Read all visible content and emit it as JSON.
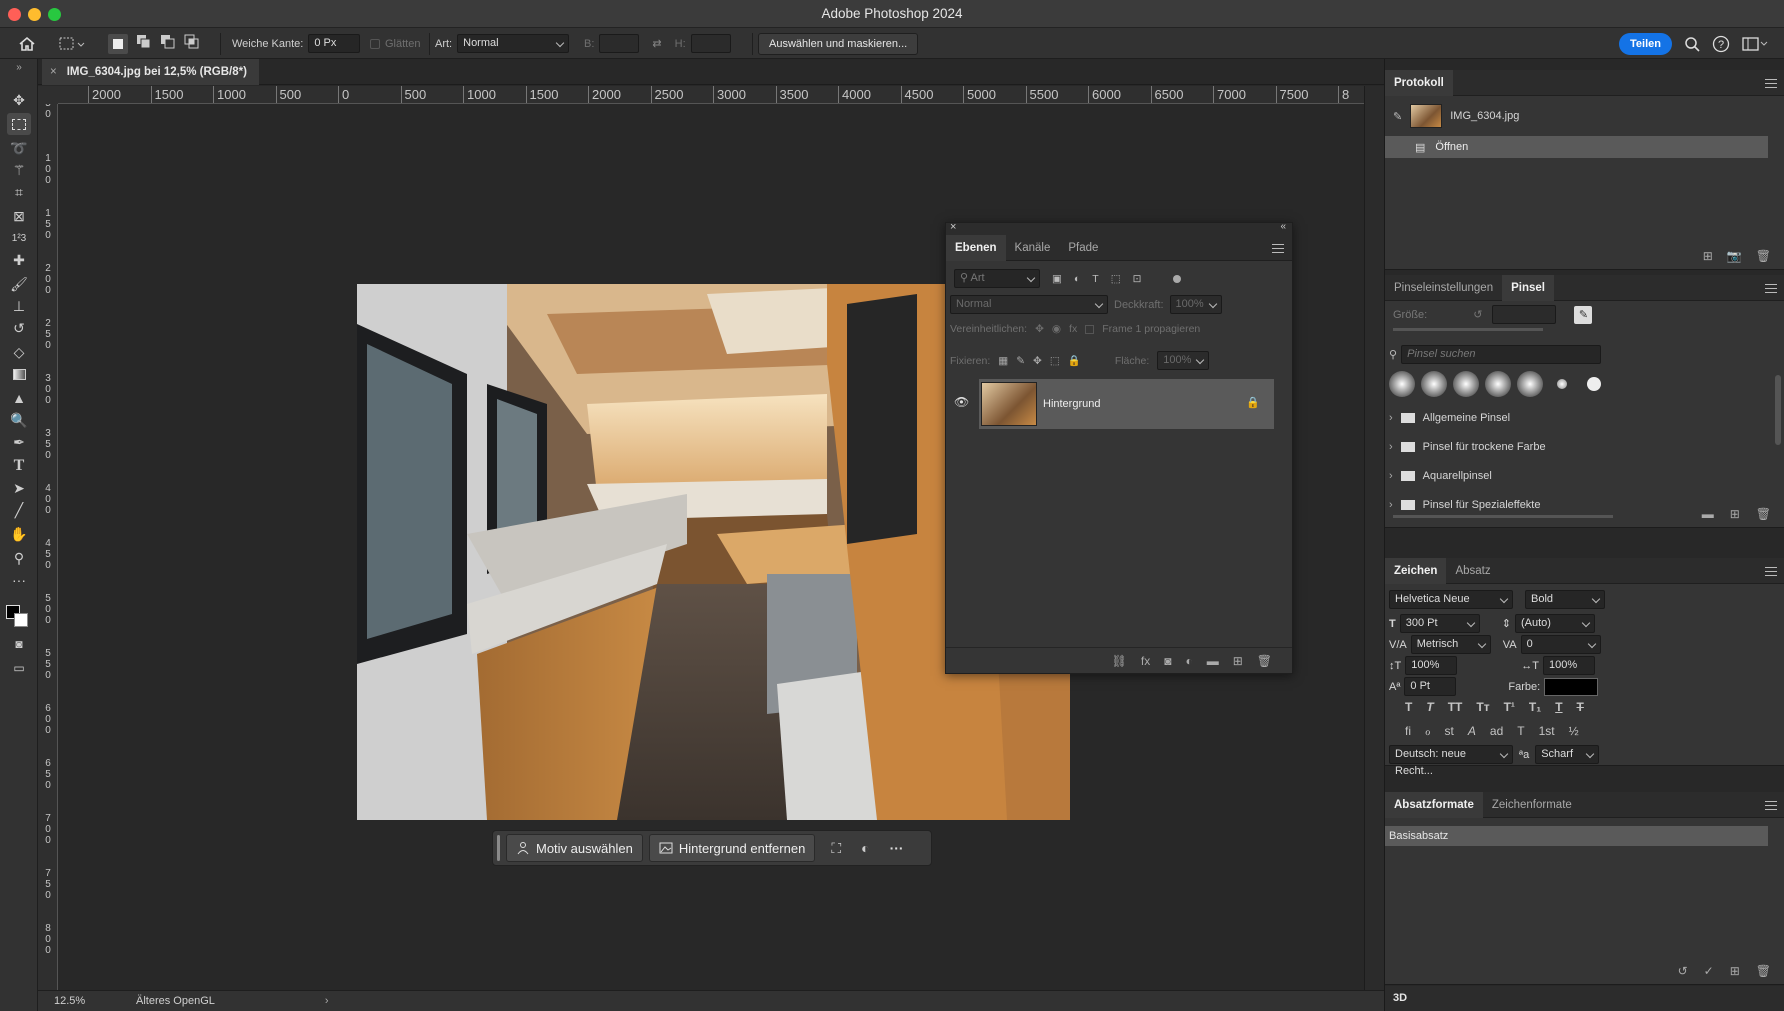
{
  "window": {
    "title": "Adobe Photoshop 2024",
    "share_label": "Teilen"
  },
  "options": {
    "feather_label": "Weiche Kante:",
    "feather_value": "0 Px",
    "antialias_label": "Glätten",
    "style_label": "Art:",
    "style_value": "Normal",
    "width_label": "B:",
    "height_label": "H:",
    "select_mask_label": "Auswählen und maskieren..."
  },
  "document": {
    "tab_title": "IMG_6304.jpg bei 12,5% (RGB/8*)",
    "zoom": "12.5%",
    "status": "Älteres OpenGL",
    "h_ruler": [
      "2000",
      "1500",
      "1000",
      "500",
      "0",
      "500",
      "1000",
      "1500",
      "2000",
      "2500",
      "3000",
      "3500",
      "4000",
      "4500",
      "5000",
      "5500",
      "6000",
      "6500",
      "7000",
      "7500",
      "8"
    ],
    "v_ruler": [
      "5\n0",
      "1\n0\n0",
      "1\n5\n0",
      "2\n0\n0",
      "2\n5\n0",
      "3\n0\n0",
      "3\n5\n0",
      "4\n0\n0",
      "4\n5\n0",
      "5\n0\n0",
      "5\n5\n0",
      "6\n0\n0",
      "6\n5\n0",
      "7\n0\n0",
      "7\n5\n0",
      "8\n0\n0"
    ]
  },
  "contextbar": {
    "subject_label": "Motiv auswählen",
    "remove_bg_label": "Hintergrund entfernen"
  },
  "layers_panel": {
    "tabs": [
      "Ebenen",
      "Kanäle",
      "Pfade"
    ],
    "filter_placeholder": "Art",
    "blend_mode": "Normal",
    "opacity_label": "Deckkraft:",
    "opacity_value": "100%",
    "unify_label": "Vereinheitlichen:",
    "propagate_label": "Frame 1 propagieren",
    "lock_label": "Fixieren:",
    "fill_label": "Fläche:",
    "fill_value": "100%",
    "layer_name": "Hintergrund"
  },
  "history_panel": {
    "title": "Protokoll",
    "snapshot": "IMG_6304.jpg",
    "step": "Öffnen"
  },
  "brush_panel": {
    "tabs": [
      "Pinseleinstellungen",
      "Pinsel"
    ],
    "size_label": "Größe:",
    "search_placeholder": "Pinsel suchen",
    "groups": [
      "Allgemeine Pinsel",
      "Pinsel für trockene Farbe",
      "Aquarellpinsel",
      "Pinsel für Spezialeffekte"
    ]
  },
  "character_panel": {
    "tabs": [
      "Zeichen",
      "Absatz"
    ],
    "font_family": "Helvetica Neue",
    "font_style": "Bold",
    "size": "300 Pt",
    "leading": "(Auto)",
    "kerning": "Metrisch",
    "tracking": "0",
    "v_scale": "100%",
    "h_scale": "100%",
    "baseline": "0 Pt",
    "color_label": "Farbe:",
    "color": "#000000",
    "language": "Deutsch: neue Recht...",
    "antialias": "Scharf",
    "style_buttons": [
      "T",
      "T",
      "TT",
      "Tт",
      "T¹",
      "T₁",
      "T",
      "T"
    ],
    "ot_buttons": [
      "fi",
      "ℴ",
      "st",
      "A",
      "ad",
      "T",
      "1st",
      "½"
    ]
  },
  "paragraph_styles_panel": {
    "tabs": [
      "Absatzformate",
      "Zeichenformate"
    ],
    "item": "Basisabsatz"
  },
  "threed_label": "3D",
  "colors": {
    "accent": "#1473e6",
    "panel": "#353535",
    "canvas": "#282828"
  }
}
